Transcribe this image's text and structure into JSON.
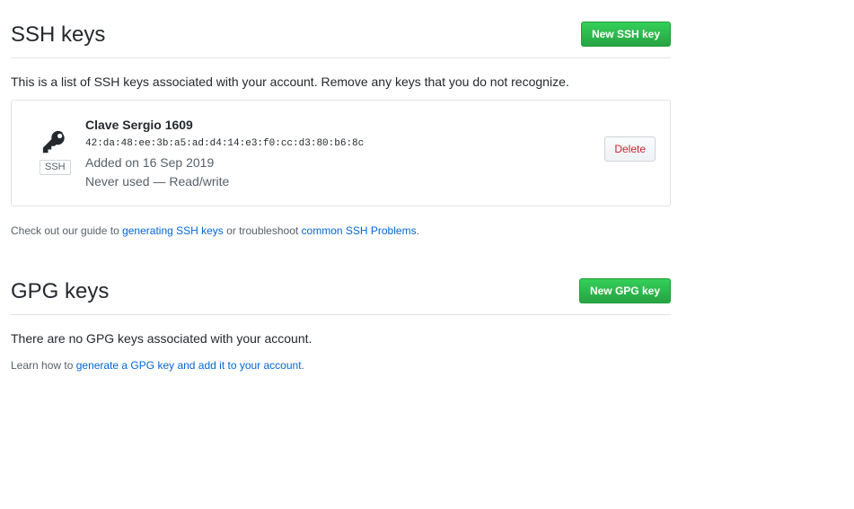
{
  "ssh": {
    "title": "SSH keys",
    "new_button": "New SSH key",
    "description": "This is a list of SSH keys associated with your account. Remove any keys that you do not recognize.",
    "keys": [
      {
        "name": "Clave Sergio 1609",
        "fingerprint": "42:da:48:ee:3b:a5:ad:d4:14:e3:f0:cc:d3:80:b6:8c",
        "added": "Added on 16 Sep 2019",
        "usage": "Never used — Read/write",
        "badge": "SSH",
        "icon": "key-icon",
        "delete_label": "Delete"
      }
    ],
    "help": {
      "prefix": "Check out our guide to ",
      "link1": "generating SSH keys",
      "middle": " or troubleshoot ",
      "link2": "common SSH Problems",
      "suffix": "."
    }
  },
  "gpg": {
    "title": "GPG keys",
    "new_button": "New GPG key",
    "empty_message": "There are no GPG keys associated with your account.",
    "help": {
      "prefix": "Learn how to ",
      "link": "generate a GPG key and add it to your account",
      "suffix": "."
    }
  },
  "colors": {
    "primary_green": "#28a745",
    "link_blue": "#0366d6",
    "danger_red": "#cb2431",
    "border": "#e1e4e8"
  }
}
